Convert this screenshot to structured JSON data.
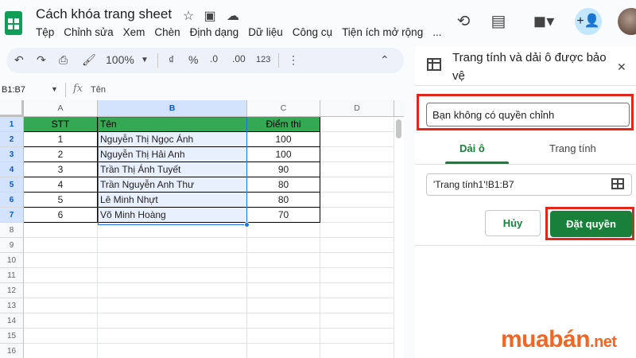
{
  "app": {
    "doc_title": "Cách khóa trang sheet",
    "menu": [
      "Tệp",
      "Chỉnh sửa",
      "Xem",
      "Chèn",
      "Định dạng",
      "Dữ liệu",
      "Công cụ",
      "Tiện ích mở rộng",
      "..."
    ]
  },
  "toolbar": {
    "zoom": "100%",
    "currency": "₫",
    "percent": "%",
    "dec_less": ".0",
    "dec_more": ".00",
    "number_format": "123"
  },
  "formula_bar": {
    "name_box": "B1:B7",
    "fx": "fx",
    "value": "Tên"
  },
  "sheet": {
    "columns": [
      "A",
      "B",
      "C",
      "D"
    ],
    "row_numbers": [
      "1",
      "2",
      "3",
      "4",
      "5",
      "6",
      "7",
      "8",
      "9",
      "10",
      "11",
      "12",
      "13",
      "14",
      "15",
      "16"
    ],
    "header": {
      "stt": "STT",
      "ten": "Tên",
      "diem": "Điểm thi"
    },
    "rows": [
      {
        "stt": "1",
        "ten": "Nguyễn Thị Ngọc Ánh",
        "diem": "100"
      },
      {
        "stt": "2",
        "ten": "Nguyễn Thị Hải Anh",
        "diem": "100"
      },
      {
        "stt": "3",
        "ten": "Trần Thị Ánh Tuyết",
        "diem": "90"
      },
      {
        "stt": "4",
        "ten": "Trần Nguyễn Anh Thư",
        "diem": "80"
      },
      {
        "stt": "5",
        "ten": "Lê Minh Nhựt",
        "diem": "80"
      },
      {
        "stt": "6",
        "ten": "Võ Minh Hoàng",
        "diem": "70"
      }
    ],
    "header_color": "#34a853",
    "selection_color": "#1a73e8"
  },
  "panel": {
    "title": "Trang tính và dải ô được bảo vệ",
    "description_value": "Bạn không có quyền chỉnh",
    "tabs": {
      "range": "Dải ô",
      "sheet": "Trang tính"
    },
    "range_value": "'Trang tính1'!B1:B7",
    "cancel_label": "Hủy",
    "confirm_label": "Đặt quyền",
    "accent_color": "#188038",
    "highlight_color": "#e1261c"
  },
  "watermark": {
    "main": "muabán",
    "suffix": ".net",
    "color": "#f26522"
  }
}
